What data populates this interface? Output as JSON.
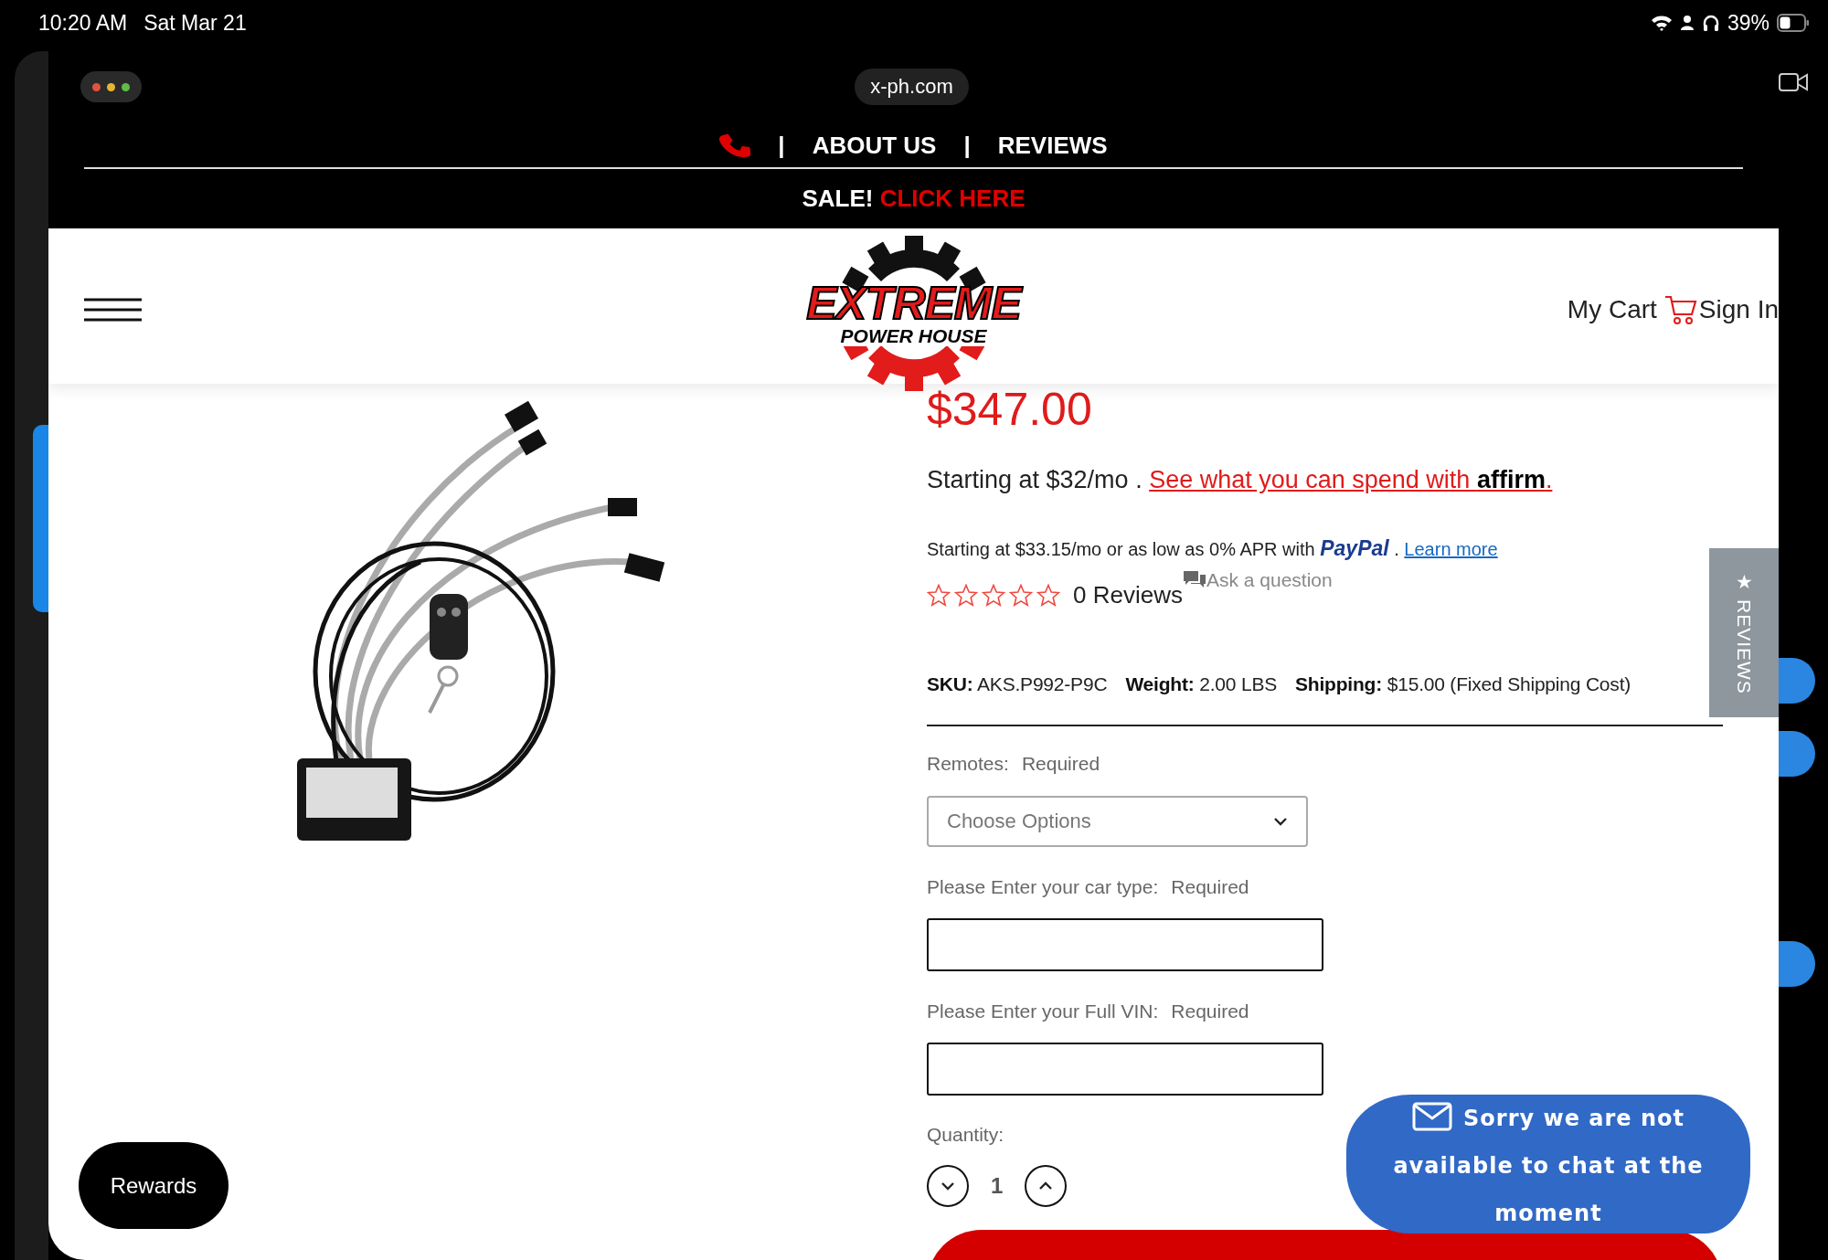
{
  "status_bar": {
    "time": "10:20 AM",
    "date": "Sat Mar 21",
    "battery": "39%"
  },
  "browser": {
    "url": "x-ph.com"
  },
  "top_nav": [
    {
      "kind": "phone"
    },
    {
      "kind": "separator",
      "text": "|"
    },
    {
      "kind": "link",
      "text": "ABOUT US"
    },
    {
      "kind": "separator",
      "text": "|"
    },
    {
      "kind": "link",
      "text": "REVIEWS"
    }
  ],
  "sale_banner": {
    "text": "SALE!",
    "link": "CLICK HERE"
  },
  "header": {
    "logo_title": "EXTREME",
    "logo_subtitle": "POWER HOUSE",
    "cart": "My Cart",
    "sign_in": "Sign In"
  },
  "product": {
    "price": "$347.00",
    "affirm": {
      "text": "Starting at $32/mo .",
      "link": "See what you can spend with **affirm**."
    },
    "paypal": {
      "text": "Starting at $33.15/mo or as low as 0% APR with **PayPal** .",
      "link": "Learn more"
    },
    "rating": {
      "stars": 0,
      "reviews": "0 Reviews",
      "ask": "Ask a question"
    },
    "specs": [
      {
        "label": "SKU:",
        "value": "AKS.P992-P9C"
      },
      {
        "label": "Weight:",
        "value": "2.00 LBS"
      },
      {
        "label": "Shipping:",
        "value": "$15.00 (Fixed Shipping Cost)"
      }
    ],
    "options": [
      {
        "kind": "select",
        "label": "Remotes:",
        "required": "Required",
        "placeholder": "Choose Options"
      },
      {
        "kind": "text",
        "label": "Please Enter your car type:",
        "required": "Required"
      },
      {
        "kind": "text",
        "label": "Please Enter your Full VIN:",
        "required": "Required"
      }
    ],
    "quantity": {
      "label": "Quantity:",
      "value": "1"
    }
  },
  "reviews_tab": {
    "icon": "★",
    "label": "REVIEWS"
  },
  "chat": {
    "text": "Sorry we are not available to chat at the moment"
  },
  "rewards": {
    "label": "Rewards"
  }
}
